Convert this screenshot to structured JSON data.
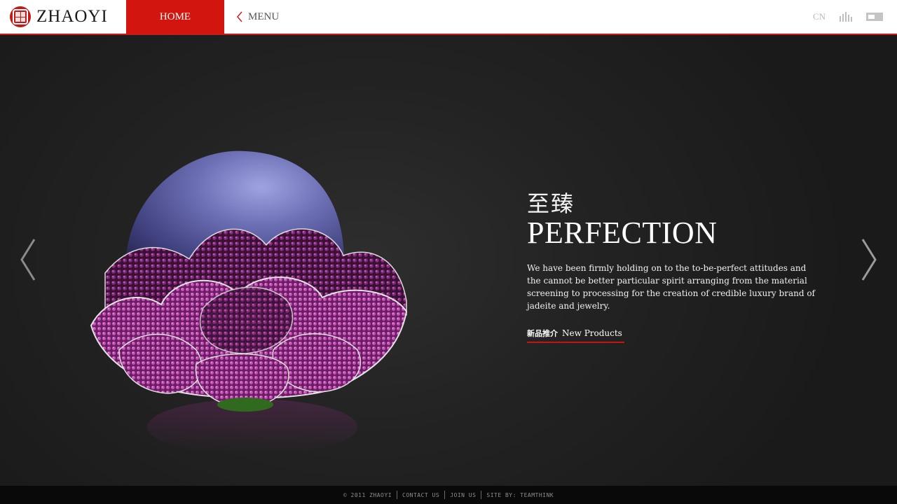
{
  "header": {
    "logo_text": "ZHAOYI",
    "home_label": "HOME",
    "menu_label": "MENU",
    "lang_label": "CN"
  },
  "hero": {
    "title_cn": "至臻",
    "title_en": "PERFECTION",
    "description": "We have been firmly holding on to the to-be-perfect attitudes and the cannot be better particular spirit arranging from the material screening to processing for the creation of credible luxury brand of jadeite and jewelry.",
    "link_cn": "新品推介",
    "link_en": "New Products"
  },
  "footer": {
    "copyright": "© 2011 ZHAOYI",
    "contact": "CONTACT US",
    "join": "JOIN US",
    "credit": "SITE BY: TEAMTHINK"
  },
  "colors": {
    "accent_red": "#d3150f",
    "gem_purple": "#9a2c8a",
    "dome_blue": "#4a4f8e"
  },
  "icons": {
    "logo": "seal-icon",
    "menu": "chevron-left-icon",
    "stats": "bars-icon",
    "view": "window-icon",
    "prev": "chevron-left-icon",
    "next": "chevron-right-icon"
  }
}
